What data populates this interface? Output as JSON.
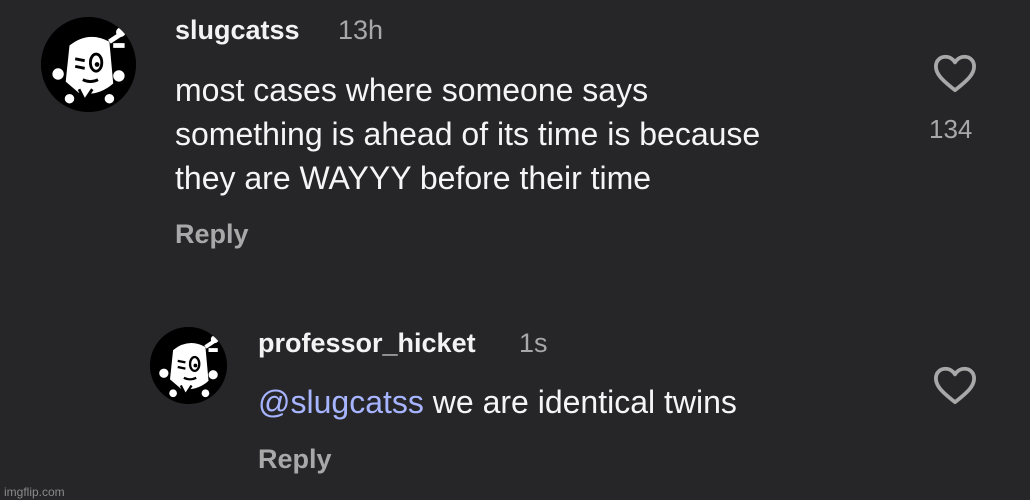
{
  "comment": {
    "username": "slugcatss",
    "time": "13h",
    "text_lines": [
      "most cases where someone says",
      "something is ahead of its time is because",
      "they are WAYYY before their time"
    ],
    "reply_label": "Reply",
    "like_count": "134",
    "avatar_icon": "cartoon-avatar-icon",
    "like_icon": "heart-outline-icon"
  },
  "reply": {
    "username": "professor_hicket",
    "time": "1s",
    "mention": "@slugcatss",
    "text": " we are identical twins",
    "reply_label": "Reply",
    "avatar_icon": "cartoon-avatar-icon",
    "like_icon": "heart-outline-icon"
  },
  "watermark": "imgflip.com",
  "colors": {
    "background": "#262629",
    "text": "#f5f5f5",
    "muted": "#a8a8a8",
    "mention": "#a7b4ff"
  }
}
